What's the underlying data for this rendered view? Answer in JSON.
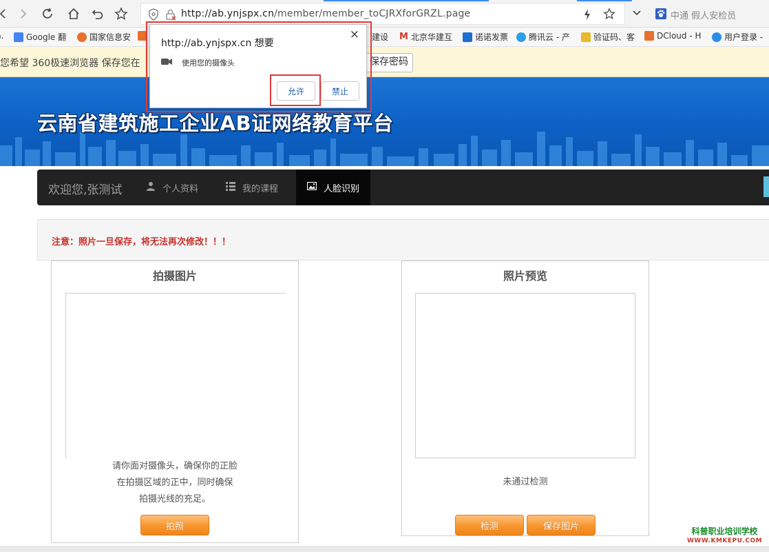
{
  "browser": {
    "url_host": "http://ab.ynjspx.cn",
    "url_path": "/member/member_toCJRXforGRZL.page",
    "search_text": "中通 假人安检员"
  },
  "bookmarks": [
    {
      "label": "Google 翻",
      "color": "#4285f4"
    },
    {
      "label": "国家信息安",
      "color": "#e8702a"
    },
    {
      "label": "建设",
      "color": "#777777"
    },
    {
      "label": "北京华建互",
      "color": "#d23b2b"
    },
    {
      "label": "诺诺发票",
      "color": "#1e6fd0"
    },
    {
      "label": "腾讯云 - 产",
      "color": "#2aa0e8"
    },
    {
      "label": "验证码、客",
      "color": "#e8b92a"
    },
    {
      "label": "DCloud - H",
      "color": "#e8702a"
    },
    {
      "label": "用户登录 -",
      "color": "#2a8de8"
    }
  ],
  "password_bar": {
    "text": "您希望 360极速浏览器 保存您在",
    "save_label": "保存密码"
  },
  "banner": {
    "title": "云南省建筑施工企业AB证网络教育平台"
  },
  "nav": {
    "brand": "欢迎您,张测试",
    "items": [
      {
        "label": "个人资料",
        "icon": "user-icon"
      },
      {
        "label": "我的课程",
        "icon": "list-icon"
      },
      {
        "label": "人脸识别",
        "icon": "picture-icon"
      }
    ]
  },
  "notice": {
    "text": "注意：照片一旦保存，将无法再次修改！！！"
  },
  "capture_panel": {
    "title": "拍摄图片",
    "instructions": [
      "请你面对摄像头，确保你的正脸",
      "在拍摄区域的正中，同时确保",
      "拍摄光线的充足。"
    ],
    "capture_label": "拍照"
  },
  "preview_panel": {
    "title": "照片预览",
    "status": "未通过检测",
    "detect_label": "检测",
    "save_label": "保存图片"
  },
  "permission_popup": {
    "title": "http://ab.ynjspx.cn 想要",
    "request": "使用您的摄像头",
    "allow_label": "允许",
    "deny_label": "禁止",
    "close_glyph": "×"
  },
  "watermark": {
    "line1": "科普职业培训学校",
    "line2": "WWW.KMKEPU.COM"
  },
  "colors": {
    "banner_blue": "#0c5fc2",
    "notice_red": "#c9302c",
    "button_orange": "#f7962e",
    "highlight_red": "#e03a3a"
  }
}
